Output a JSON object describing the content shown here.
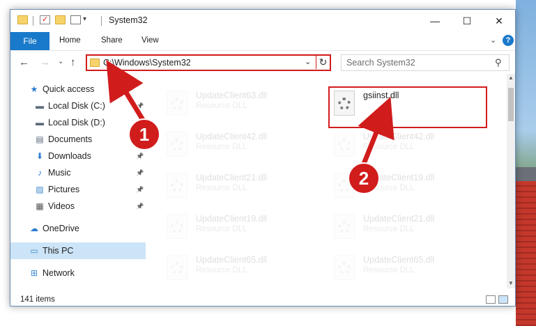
{
  "window": {
    "title": "System32",
    "minimize_glyph": "—",
    "maximize_glyph": "☐",
    "close_glyph": "✕"
  },
  "quick_access_toolbar": {
    "customize_glyph": "▾"
  },
  "ribbon": {
    "tabs": [
      "File",
      "Home",
      "Share",
      "View"
    ],
    "expand_glyph": "⌄",
    "help_glyph": "?"
  },
  "navigation": {
    "back_glyph": "←",
    "forward_glyph": "→",
    "recent_glyph": "⌄",
    "up_glyph": "↑"
  },
  "address_bar": {
    "path": "C:\\Windows\\System32",
    "dropdown_glyph": "⌄",
    "refresh_glyph": "↻"
  },
  "search": {
    "placeholder": "Search System32",
    "icon": "search-icon",
    "icon_glyph": "⚲"
  },
  "sidebar": {
    "items": [
      {
        "label": "Quick access",
        "icon": "star-icon",
        "glyph": "★",
        "color": "#2a7bd4",
        "pinned": false
      },
      {
        "label": "Local Disk (C:)",
        "icon": "drive-icon",
        "glyph": "▬",
        "color": "#5a6a7a",
        "pinned": true
      },
      {
        "label": "Local Disk (D:)",
        "icon": "drive-icon",
        "glyph": "▬",
        "color": "#5a6a7a",
        "pinned": true
      },
      {
        "label": "Documents",
        "icon": "document-icon",
        "glyph": "▤",
        "color": "#5a6a7a",
        "pinned": true
      },
      {
        "label": "Downloads",
        "icon": "download-icon",
        "glyph": "⬇",
        "color": "#2a7bd4",
        "pinned": true
      },
      {
        "label": "Music",
        "icon": "music-icon",
        "glyph": "♪",
        "color": "#2a7bd4",
        "pinned": true
      },
      {
        "label": "Pictures",
        "icon": "pictures-icon",
        "glyph": "▨",
        "color": "#3a8ad0",
        "pinned": true
      },
      {
        "label": "Videos",
        "icon": "video-icon",
        "glyph": "▦",
        "color": "#555555",
        "pinned": true
      },
      {
        "label": "OneDrive",
        "icon": "cloud-icon",
        "glyph": "☁",
        "color": "#2a7bd4",
        "pinned": false
      },
      {
        "label": "This PC",
        "icon": "computer-icon",
        "glyph": "▭",
        "color": "#3a8ad0",
        "pinned": false
      },
      {
        "label": "Network",
        "icon": "network-icon",
        "glyph": "⊞",
        "color": "#3a8ad0",
        "pinned": false
      }
    ],
    "pin_glyph": "📌"
  },
  "files": [
    {
      "name": "UpdateClient63.dll",
      "type": "Resource DLL"
    },
    {
      "name": "gsiinst.dll",
      "type": ""
    },
    {
      "name": "UpdateClient42.dll",
      "type": "Resource DLL"
    },
    {
      "name": "UpdateClient42.dll",
      "type": "Resource DLL"
    },
    {
      "name": "UpdateClient21.dll",
      "type": "Resource DLL"
    },
    {
      "name": "UpdateClient19.dll",
      "type": "Resource DLL"
    },
    {
      "name": "UpdateClient19.dll",
      "type": "Resource DLL"
    },
    {
      "name": "UpdateClient21.dll",
      "type": "Resource DLL"
    },
    {
      "name": "UpdateClient65.dll",
      "type": "Resource DLL"
    },
    {
      "name": "UpdateClient65.dll",
      "type": "Resource DLL"
    }
  ],
  "status_bar": {
    "item_count": "141 items"
  },
  "annotations": {
    "step1": "1",
    "step2": "2",
    "color": "#d11c1c"
  },
  "colors": {
    "accent": "#1979ca",
    "selection": "#cce4f7",
    "highlight": "#d11c1c"
  }
}
